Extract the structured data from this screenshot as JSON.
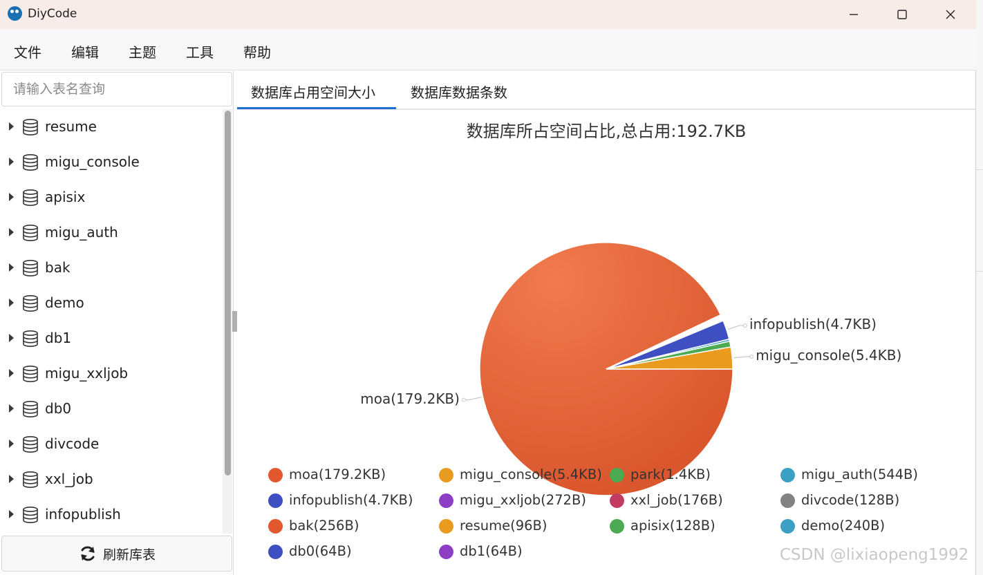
{
  "window": {
    "title": "DiyCode"
  },
  "menu": [
    "文件",
    "编辑",
    "主题",
    "工具",
    "帮助"
  ],
  "sidebar": {
    "search_placeholder": "请输入表名查询",
    "databases": [
      "resume",
      "migu_console",
      "apisix",
      "migu_auth",
      "bak",
      "demo",
      "db1",
      "migu_xxljob",
      "db0",
      "divcode",
      "xxl_job",
      "infopublish"
    ],
    "refresh_label": "刷新库表"
  },
  "tabs": [
    "数据库占用空间大小",
    "数据库数据条数"
  ],
  "active_tab": 0,
  "watermark": "CSDN @lixiaopeng1992",
  "chart_data": {
    "type": "pie",
    "title": "数据库所占空间占比,总占用:192.7KB",
    "unit": "KB",
    "slices": [
      {
        "name": "moa",
        "label": "moa(179.2KB)",
        "value": 179.2,
        "color": "#e2582c"
      },
      {
        "name": "migu_console",
        "label": "migu_console(5.4KB)",
        "value": 5.4,
        "color": "#e89b1e"
      },
      {
        "name": "park",
        "label": "park(1.4KB)",
        "value": 1.4,
        "color": "#4caa53"
      },
      {
        "name": "migu_auth",
        "label": "migu_auth(544B)",
        "value": 0.531,
        "color": "#3aa0c4"
      },
      {
        "name": "infopublish",
        "label": "infopublish(4.7KB)",
        "value": 4.7,
        "color": "#3e4fc1"
      },
      {
        "name": "migu_xxljob",
        "label": "migu_xxljob(272B)",
        "value": 0.266,
        "color": "#8e3ec4"
      },
      {
        "name": "xxl_job",
        "label": "xxl_job(176B)",
        "value": 0.172,
        "color": "#c23b62"
      },
      {
        "name": "divcode",
        "label": "divcode(128B)",
        "value": 0.125,
        "color": "#828282"
      },
      {
        "name": "bak",
        "label": "bak(256B)",
        "value": 0.25,
        "color": "#e2582c"
      },
      {
        "name": "resume",
        "label": "resume(96B)",
        "value": 0.094,
        "color": "#e89b1e"
      },
      {
        "name": "apisix",
        "label": "apisix(128B)",
        "value": 0.125,
        "color": "#4caa53"
      },
      {
        "name": "demo",
        "label": "demo(240B)",
        "value": 0.234,
        "color": "#3aa0c4"
      },
      {
        "name": "db0",
        "label": "db0(64B)",
        "value": 0.0625,
        "color": "#3e4fc1"
      },
      {
        "name": "db1",
        "label": "db1(64B)",
        "value": 0.0625,
        "color": "#8e3ec4"
      }
    ],
    "outside_labels": [
      "moa(179.2KB)",
      "migu_console(5.4KB)",
      "infopublish(4.7KB)"
    ],
    "legend_position": "bottom"
  }
}
